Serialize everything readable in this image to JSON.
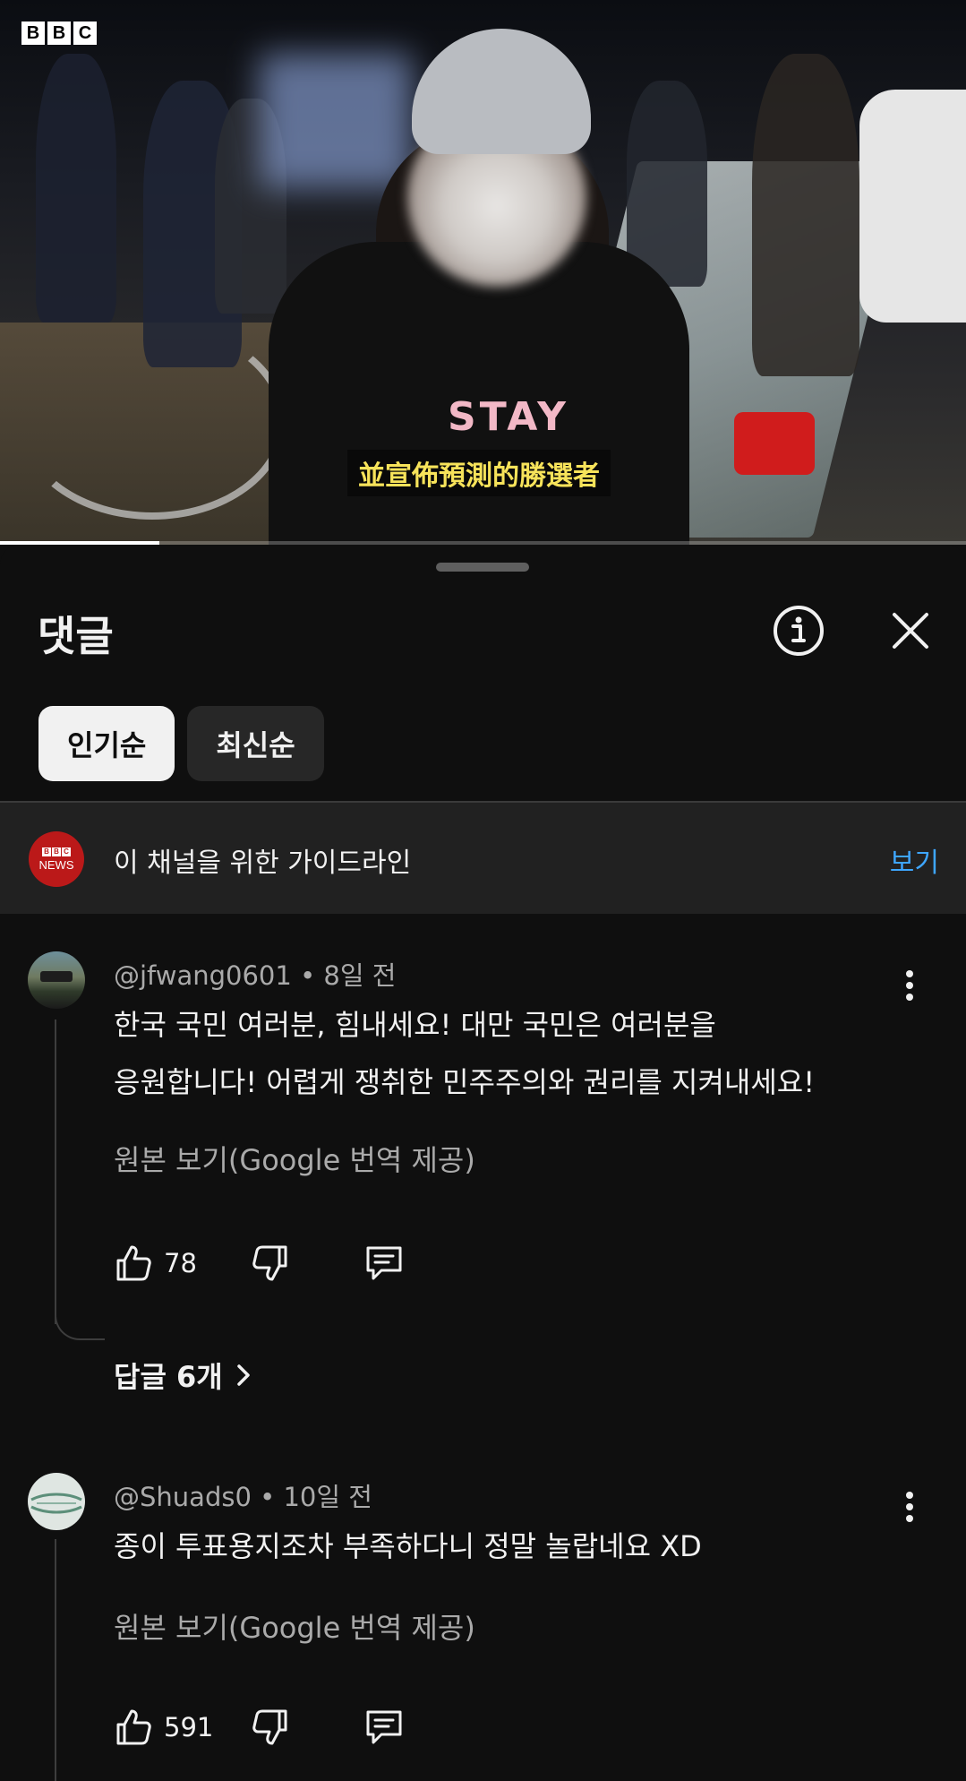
{
  "video": {
    "channel_logo": [
      "B",
      "B",
      "C"
    ],
    "subtitle": "並宣佈預測的勝選者",
    "shirt_text": "STAY",
    "progress_fraction": 0.165
  },
  "sheet": {
    "title": "댓글",
    "info_icon": "info-icon",
    "close_icon": "close-icon",
    "chips": [
      {
        "label": "인기순",
        "active": true
      },
      {
        "label": "최신순",
        "active": false
      }
    ]
  },
  "guideline": {
    "avatar_letters": [
      "B",
      "B",
      "C"
    ],
    "avatar_text": "NEWS",
    "text": "이 채널을 위한 가이드라인",
    "link": "보기"
  },
  "comments": [
    {
      "handle": "@jfwang0601",
      "age": "8일 전",
      "lines": [
        "한국 국민 여러분, 힘내세요! 대만 국민은 여러분을",
        "응원합니다! 어렵게 쟁취한 민주주의와 권리를 지켜내세요!"
      ],
      "translate": "원본 보기(Google 번역 제공)",
      "likes": "78",
      "replies": "답글 6개"
    },
    {
      "handle": "@Shuads0",
      "age": "10일 전",
      "lines": [
        "종이 투표용지조차 부족하다니 정말 놀랍네요 XD"
      ],
      "translate": "원본 보기(Google 번역 제공)",
      "likes": "591"
    }
  ],
  "colors": {
    "background": "#0f0f0f",
    "link_blue": "#3ea6ff",
    "secondary_text": "#aaaaaa",
    "subtitle_yellow": "#f7e35a"
  }
}
